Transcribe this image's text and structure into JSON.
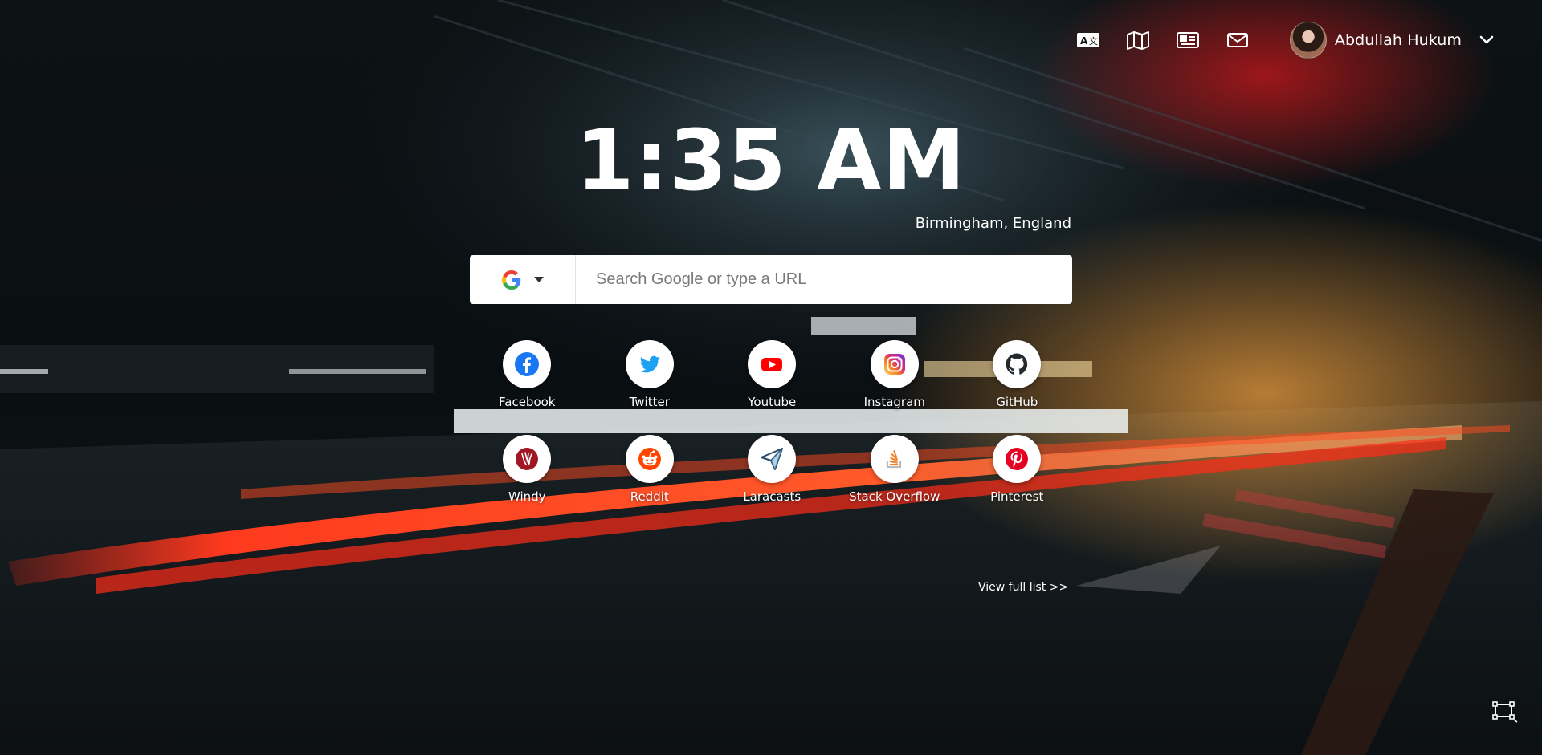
{
  "header": {
    "icons": [
      "translate-icon",
      "map-icon",
      "news-icon",
      "mail-icon"
    ],
    "user_name": "Abdullah Hukum"
  },
  "clock": {
    "time": "1:35 AM",
    "location": "Birmingham, England"
  },
  "search": {
    "engine": "Google",
    "placeholder": "Search Google or type a URL"
  },
  "shortcuts": [
    {
      "label": "Facebook",
      "icon": "facebook-icon",
      "color": "#1877f2"
    },
    {
      "label": "Twitter",
      "icon": "twitter-icon",
      "color": "#1da1f2"
    },
    {
      "label": "Youtube",
      "icon": "youtube-icon",
      "color": "#ff0000"
    },
    {
      "label": "Instagram",
      "icon": "instagram-icon",
      "color": "#c13584"
    },
    {
      "label": "GitHub",
      "icon": "github-icon",
      "color": "#24292e"
    },
    {
      "label": "Windy",
      "icon": "windy-icon",
      "color": "#a01622"
    },
    {
      "label": "Reddit",
      "icon": "reddit-icon",
      "color": "#ff4500"
    },
    {
      "label": "Laracasts",
      "icon": "laracasts-icon",
      "color": "#2a4a6a"
    },
    {
      "label": "Stack Overflow",
      "icon": "stackoverflow-icon",
      "color": "#f48024"
    },
    {
      "label": "Pinterest",
      "icon": "pinterest-icon",
      "color": "#e60023"
    }
  ],
  "view_all_label": "View full list >>",
  "footer": {
    "icon": "screen-capture-icon"
  }
}
